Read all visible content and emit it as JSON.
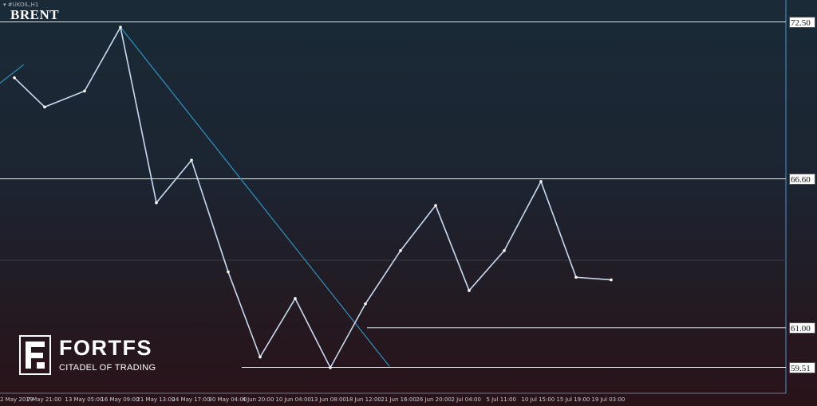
{
  "symbol_label": "#UKOIL,H1",
  "chart_data": {
    "type": "line",
    "title": "BRENT",
    "series": [
      {
        "x": [
          "2 May 2019",
          "7 May 21:00",
          "13 May 05:00",
          "16 May 09:00",
          "21 May 13:00",
          "24 May 17:00",
          "30 May 04:00",
          "4 Jun 20:00",
          "10 Jun 04:00",
          "13 Jun 08:00",
          "18 Jun 12:00",
          "21 Jun 16:00",
          "26 Jun 20:00",
          "2 Jul 04:00",
          "5 Jul 11:00",
          "10 Jul 15:00",
          "15 Jul 19:00",
          "19 Jul 03:00"
        ],
        "values": [
          70.4,
          69.3,
          69.9,
          72.3,
          65.7,
          67.3,
          63.1,
          59.9,
          62.1,
          59.5,
          61.9,
          63.9,
          65.6,
          62.4,
          63.9,
          66.5,
          62.9,
          62.8
        ]
      }
    ],
    "x_tick_labels": [
      "2 May 2019",
      "7 May 21:00",
      "13 May 05:00",
      "16 May 09:00",
      "21 May 13:00",
      "24 May 17:00",
      "30 May 04:00",
      "4 Jun 20:00",
      "10 Jun 04:00",
      "13 Jun 08:00",
      "18 Jun 12:00",
      "21 Jun 16:00",
      "26 Jun 20:00",
      "2 Jul 04:00",
      "5 Jul 11:00",
      "10 Jul 15:00",
      "15 Jul 19:00",
      "19 Jul 03:00"
    ],
    "ylim": [
      58.0,
      73.0
    ],
    "levels": [
      {
        "label": "72.50",
        "value": 72.5
      },
      {
        "label": "66.60",
        "value": 66.6
      },
      {
        "label": "61.00",
        "value": 61.0
      },
      {
        "label": "59.51",
        "value": 59.51
      }
    ],
    "trendlines": [
      {
        "from": {
          "x": "2 May 2019",
          "y": 70.2
        },
        "to": {
          "x": "7 May 21:00",
          "y": 70.9
        }
      },
      {
        "from": {
          "x": "16 May 09:00",
          "y": 72.3
        },
        "to": {
          "x": "21 Jun 16:00",
          "y": 59.55
        }
      }
    ],
    "colors": {
      "line": "#c9daf0",
      "level": "#dfe4ea",
      "trend": "#2e93bf",
      "separator": "#4d96c8"
    },
    "grid": false
  },
  "logo": {
    "name": "FORTFS",
    "tagline": "CITADEL OF TRADING"
  }
}
